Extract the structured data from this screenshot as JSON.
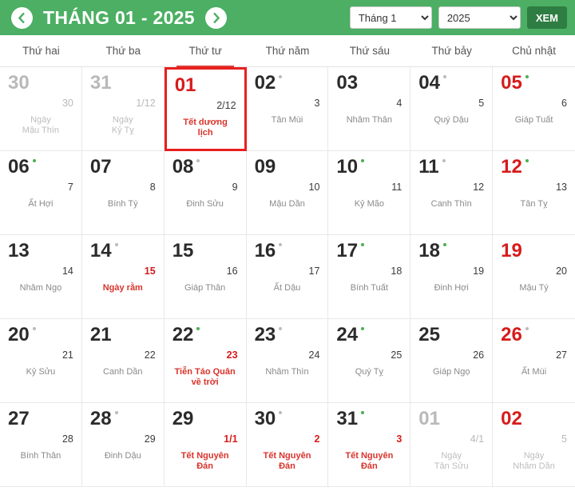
{
  "header": {
    "prev_icon": "chevron-left-icon",
    "next_icon": "chevron-right-icon",
    "title": "THÁNG 01 - 2025",
    "month_select_value": "Tháng 1",
    "year_select_value": "2025",
    "view_button_label": "XEM",
    "accent_color": "#4caf63",
    "button_color": "#2e7d42"
  },
  "weekdays": [
    {
      "label": "Thứ hai",
      "active": false
    },
    {
      "label": "Thứ ba",
      "active": false
    },
    {
      "label": "Thứ tư",
      "active": true
    },
    {
      "label": "Thứ năm",
      "active": false
    },
    {
      "label": "Thứ sáu",
      "active": false
    },
    {
      "label": "Thứ bảy",
      "active": false
    },
    {
      "label": "Chủ nhật",
      "active": false
    }
  ],
  "days": [
    {
      "solar": "30",
      "solar_style": "muted",
      "dot": "none",
      "lunar": "30",
      "lunar_style": "muted",
      "note": "Ngày\nMậu Thìn",
      "note_style": "muted",
      "today": false
    },
    {
      "solar": "31",
      "solar_style": "muted",
      "dot": "none",
      "lunar": "1/12",
      "lunar_style": "muted",
      "note": "Ngày\nKỷ Tỵ",
      "note_style": "muted",
      "today": false
    },
    {
      "solar": "01",
      "solar_style": "red",
      "dot": "none",
      "lunar": "2/12",
      "lunar_style": "normal",
      "note": "Tết dương lịch",
      "note_style": "red",
      "today": true
    },
    {
      "solar": "02",
      "solar_style": "normal",
      "dot": "gray",
      "lunar": "3",
      "lunar_style": "normal",
      "note": "Tân Mùi",
      "note_style": "normal",
      "today": false
    },
    {
      "solar": "03",
      "solar_style": "normal",
      "dot": "none",
      "lunar": "4",
      "lunar_style": "normal",
      "note": "Nhâm Thân",
      "note_style": "normal",
      "today": false
    },
    {
      "solar": "04",
      "solar_style": "normal",
      "dot": "gray",
      "lunar": "5",
      "lunar_style": "normal",
      "note": "Quý Dậu",
      "note_style": "normal",
      "today": false
    },
    {
      "solar": "05",
      "solar_style": "red",
      "dot": "green",
      "lunar": "6",
      "lunar_style": "normal",
      "note": "Giáp Tuất",
      "note_style": "normal",
      "today": false
    },
    {
      "solar": "06",
      "solar_style": "normal",
      "dot": "green",
      "lunar": "7",
      "lunar_style": "normal",
      "note": "Ất Hợi",
      "note_style": "normal",
      "today": false
    },
    {
      "solar": "07",
      "solar_style": "normal",
      "dot": "none",
      "lunar": "8",
      "lunar_style": "normal",
      "note": "Bính Tý",
      "note_style": "normal",
      "today": false
    },
    {
      "solar": "08",
      "solar_style": "normal",
      "dot": "gray",
      "lunar": "9",
      "lunar_style": "normal",
      "note": "Đinh Sửu",
      "note_style": "normal",
      "today": false
    },
    {
      "solar": "09",
      "solar_style": "normal",
      "dot": "none",
      "lunar": "10",
      "lunar_style": "normal",
      "note": "Mậu Dần",
      "note_style": "normal",
      "today": false
    },
    {
      "solar": "10",
      "solar_style": "normal",
      "dot": "green",
      "lunar": "11",
      "lunar_style": "normal",
      "note": "Kỷ Mão",
      "note_style": "normal",
      "today": false
    },
    {
      "solar": "11",
      "solar_style": "normal",
      "dot": "gray",
      "lunar": "12",
      "lunar_style": "normal",
      "note": "Canh Thìn",
      "note_style": "normal",
      "today": false
    },
    {
      "solar": "12",
      "solar_style": "red",
      "dot": "green",
      "lunar": "13",
      "lunar_style": "normal",
      "note": "Tân Tỵ",
      "note_style": "normal",
      "today": false
    },
    {
      "solar": "13",
      "solar_style": "normal",
      "dot": "none",
      "lunar": "14",
      "lunar_style": "normal",
      "note": "Nhâm Ngọ",
      "note_style": "normal",
      "today": false
    },
    {
      "solar": "14",
      "solar_style": "normal",
      "dot": "gray",
      "lunar": "15",
      "lunar_style": "red",
      "note": "Ngày rằm",
      "note_style": "red",
      "today": false
    },
    {
      "solar": "15",
      "solar_style": "normal",
      "dot": "none",
      "lunar": "16",
      "lunar_style": "normal",
      "note": "Giáp Thân",
      "note_style": "normal",
      "today": false
    },
    {
      "solar": "16",
      "solar_style": "normal",
      "dot": "gray",
      "lunar": "17",
      "lunar_style": "normal",
      "note": "Ất Dậu",
      "note_style": "normal",
      "today": false
    },
    {
      "solar": "17",
      "solar_style": "normal",
      "dot": "green",
      "lunar": "18",
      "lunar_style": "normal",
      "note": "Bính Tuất",
      "note_style": "normal",
      "today": false
    },
    {
      "solar": "18",
      "solar_style": "normal",
      "dot": "green",
      "lunar": "19",
      "lunar_style": "normal",
      "note": "Đinh Hợi",
      "note_style": "normal",
      "today": false
    },
    {
      "solar": "19",
      "solar_style": "red",
      "dot": "none",
      "lunar": "20",
      "lunar_style": "normal",
      "note": "Mậu Tý",
      "note_style": "normal",
      "today": false
    },
    {
      "solar": "20",
      "solar_style": "normal",
      "dot": "gray",
      "lunar": "21",
      "lunar_style": "normal",
      "note": "Kỷ Sửu",
      "note_style": "normal",
      "today": false
    },
    {
      "solar": "21",
      "solar_style": "normal",
      "dot": "none",
      "lunar": "22",
      "lunar_style": "normal",
      "note": "Canh Dần",
      "note_style": "normal",
      "today": false
    },
    {
      "solar": "22",
      "solar_style": "normal",
      "dot": "green",
      "lunar": "23",
      "lunar_style": "red",
      "note": "Tiễn Táo Quân\nvề trời",
      "note_style": "red",
      "today": false
    },
    {
      "solar": "23",
      "solar_style": "normal",
      "dot": "gray",
      "lunar": "24",
      "lunar_style": "normal",
      "note": "Nhâm Thìn",
      "note_style": "normal",
      "today": false
    },
    {
      "solar": "24",
      "solar_style": "normal",
      "dot": "green",
      "lunar": "25",
      "lunar_style": "normal",
      "note": "Quý Tỵ",
      "note_style": "normal",
      "today": false
    },
    {
      "solar": "25",
      "solar_style": "normal",
      "dot": "none",
      "lunar": "26",
      "lunar_style": "normal",
      "note": "Giáp Ngọ",
      "note_style": "normal",
      "today": false
    },
    {
      "solar": "26",
      "solar_style": "red",
      "dot": "gray",
      "lunar": "27",
      "lunar_style": "normal",
      "note": "Ất Mùi",
      "note_style": "normal",
      "today": false
    },
    {
      "solar": "27",
      "solar_style": "normal",
      "dot": "none",
      "lunar": "28",
      "lunar_style": "normal",
      "note": "Bính Thân",
      "note_style": "normal",
      "today": false
    },
    {
      "solar": "28",
      "solar_style": "normal",
      "dot": "gray",
      "lunar": "29",
      "lunar_style": "normal",
      "note": "Đinh Dậu",
      "note_style": "normal",
      "today": false
    },
    {
      "solar": "29",
      "solar_style": "normal",
      "dot": "none",
      "lunar": "1/1",
      "lunar_style": "red",
      "note": "Tết Nguyên\nĐán",
      "note_style": "red",
      "today": false
    },
    {
      "solar": "30",
      "solar_style": "normal",
      "dot": "gray",
      "lunar": "2",
      "lunar_style": "red",
      "note": "Tết Nguyên\nĐán",
      "note_style": "red",
      "today": false
    },
    {
      "solar": "31",
      "solar_style": "normal",
      "dot": "green",
      "lunar": "3",
      "lunar_style": "red",
      "note": "Tết Nguyên\nĐán",
      "note_style": "red",
      "today": false
    },
    {
      "solar": "01",
      "solar_style": "muted",
      "dot": "none",
      "lunar": "4/1",
      "lunar_style": "muted",
      "note": "Ngày\nTân Sửu",
      "note_style": "muted",
      "today": false
    },
    {
      "solar": "02",
      "solar_style": "red",
      "dot": "none",
      "lunar": "5",
      "lunar_style": "muted",
      "note": "Ngày\nNhâm Dần",
      "note_style": "muted",
      "today": false
    }
  ]
}
